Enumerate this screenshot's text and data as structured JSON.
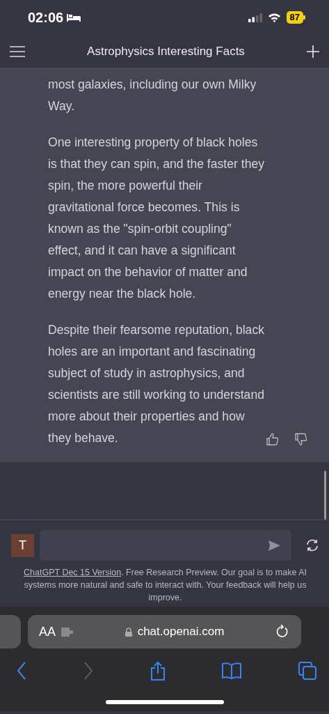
{
  "status_bar": {
    "time": "02:06",
    "battery": "87"
  },
  "header": {
    "title": "Astrophysics Interesting Facts"
  },
  "message": {
    "paragraphs": [
      "most galaxies, including our own Milky Way.",
      "One interesting property of black holes is that they can spin, and the faster they spin, the more powerful their gravitational force becomes. This is known as the \"spin-orbit coupling\" effect, and it can have a significant impact on the behavior of matter and energy near the black hole.",
      "Despite their fearsome reputation, black holes are an important and fascinating subject of study in astrophysics, and scientists are still working to understand more about their properties and how they behave."
    ]
  },
  "composer": {
    "avatar": "T"
  },
  "footer": {
    "link": "ChatGPT Dec 15 Version",
    "text": ". Free Research Preview. Our goal is to make AI systems more natural and safe to interact with. Your feedback will help us improve."
  },
  "browser": {
    "text_size": "AA",
    "url": "chat.openai.com",
    "toolbar": [
      {
        "kind": "back",
        "disabled": false
      },
      {
        "kind": "forward",
        "disabled": true
      },
      {
        "kind": "share",
        "disabled": false
      },
      {
        "kind": "bookmarks",
        "disabled": false
      },
      {
        "kind": "tabs",
        "disabled": false
      }
    ]
  }
}
